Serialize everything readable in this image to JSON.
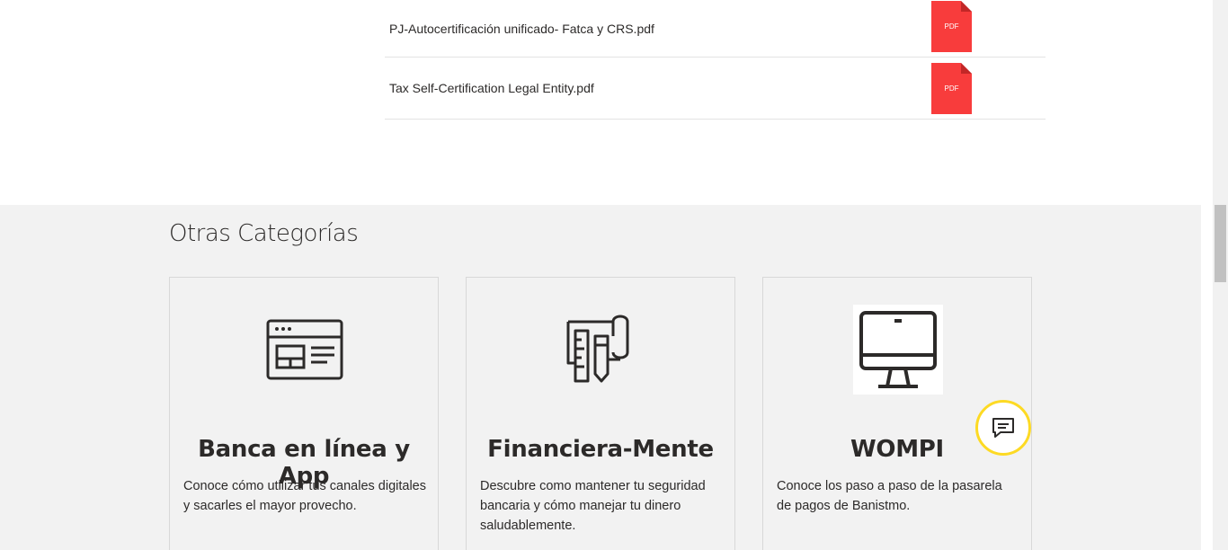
{
  "documents": [
    {
      "name": "PJ-Autocertificación unificado- Fatca y CRS.pdf",
      "icon_label": "PDF"
    },
    {
      "name": "Tax Self-Certification Legal Entity.pdf",
      "icon_label": "PDF"
    }
  ],
  "categories": {
    "title": "Otras Categorías",
    "cards": [
      {
        "title": "Banca en línea y App",
        "description": "Conoce cómo utilizar tus canales digitales y sacarles el mayor provecho.",
        "icon": "browser-window-icon"
      },
      {
        "title": "Financiera-Mente",
        "description": "Descubre como mantener tu seguridad bancaria y cómo manejar tu dinero saludablemente.",
        "icon": "ruler-pencil-icon"
      },
      {
        "title": "WOMPI",
        "description": "Conoce los paso a paso de la pasarela de pagos de Banistmo.",
        "icon": "monitor-icon"
      }
    ]
  },
  "colors": {
    "pdf_red": "#f83c3c",
    "accent_yellow": "#fdda24",
    "section_bg": "#f2f2f2",
    "text": "#2c2a29"
  },
  "chat": {
    "icon": "chat-bubble-icon"
  }
}
